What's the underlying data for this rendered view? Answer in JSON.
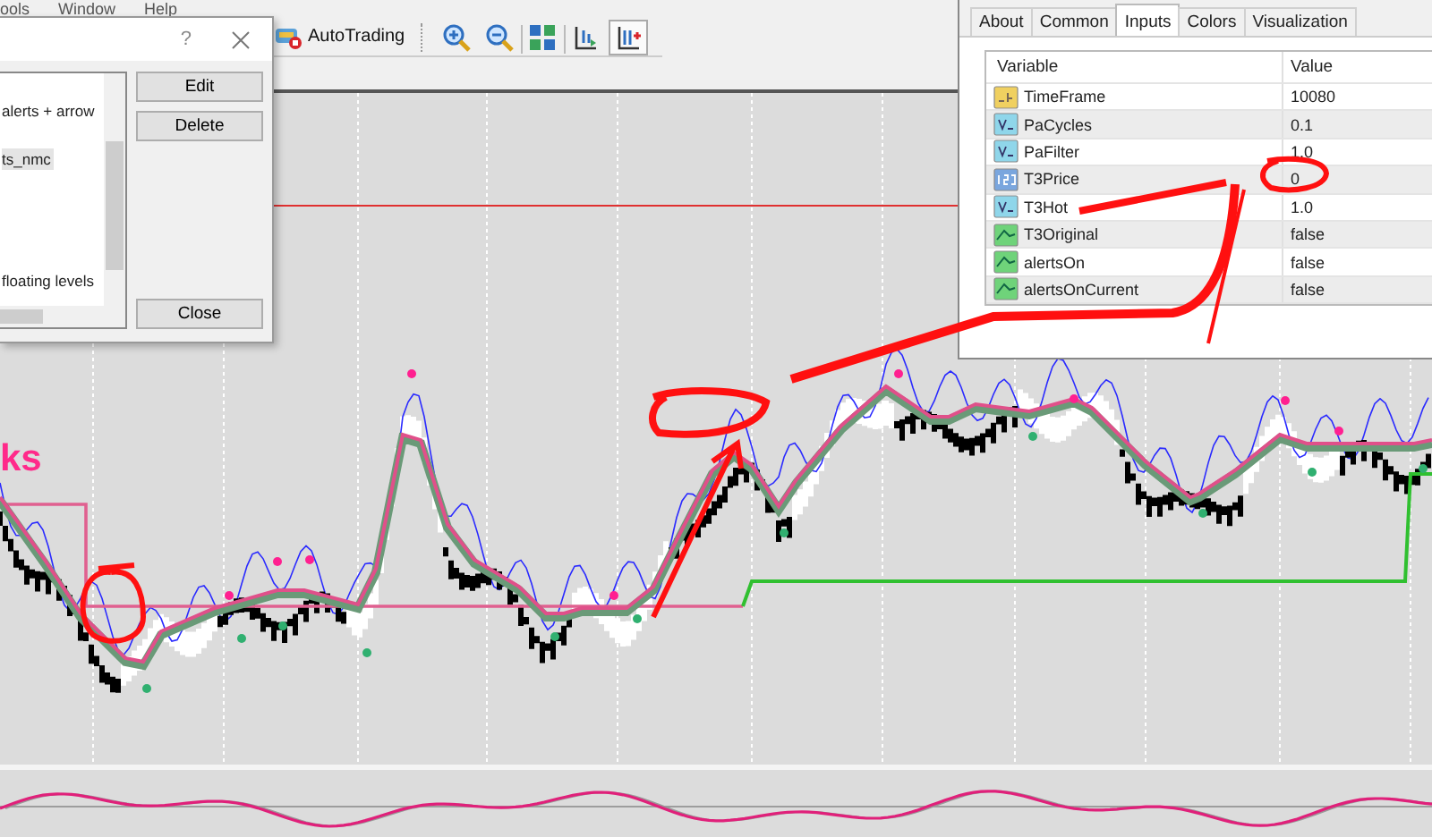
{
  "menu_bar": [
    "ools",
    "Window",
    "Help"
  ],
  "toolbar": {
    "autotrading": "AutoTrading",
    "tools": [
      {
        "kind": "zoom-in",
        "pressed": false
      },
      {
        "kind": "zoom-out",
        "pressed": false
      },
      {
        "kind": "tile",
        "pressed": false
      },
      {
        "kind": "chart-shift",
        "pressed": false
      },
      {
        "kind": "auto-scroll",
        "pressed": true
      }
    ]
  },
  "indicators_dialog": {
    "help": "?",
    "items": [
      {
        "label": "alerts + arrow",
        "selected": false
      },
      {
        "label": "ts_nmc",
        "selected": true
      },
      {
        "label": "floating levels",
        "selected": false
      }
    ],
    "buttons": [
      "Edit",
      "Delete"
    ],
    "close": "Close"
  },
  "chart": {
    "label": "ks"
  },
  "properties_dialog": {
    "tabs": [
      {
        "label": "About",
        "selected": false
      },
      {
        "label": "Common",
        "selected": false
      },
      {
        "label": "Inputs",
        "selected": true
      },
      {
        "label": "Colors",
        "selected": false
      },
      {
        "label": "Visualization",
        "selected": false
      }
    ],
    "columns": [
      "Variable",
      "Value"
    ],
    "rows": [
      {
        "kind": "string",
        "name": "TimeFrame",
        "value": "10080"
      },
      {
        "kind": "double",
        "name": "PaCycles",
        "value": "0.1"
      },
      {
        "kind": "double",
        "name": "PaFilter",
        "value": "1.0"
      },
      {
        "kind": "int",
        "name": "T3Price",
        "value": "0"
      },
      {
        "kind": "double",
        "name": "T3Hot",
        "value": "1.0"
      },
      {
        "kind": "bool",
        "name": "T3Original",
        "value": "false"
      },
      {
        "kind": "bool",
        "name": "alertsOn",
        "value": "false"
      },
      {
        "kind": "bool",
        "name": "alertsOnCurrent",
        "value": "false"
      }
    ]
  }
}
